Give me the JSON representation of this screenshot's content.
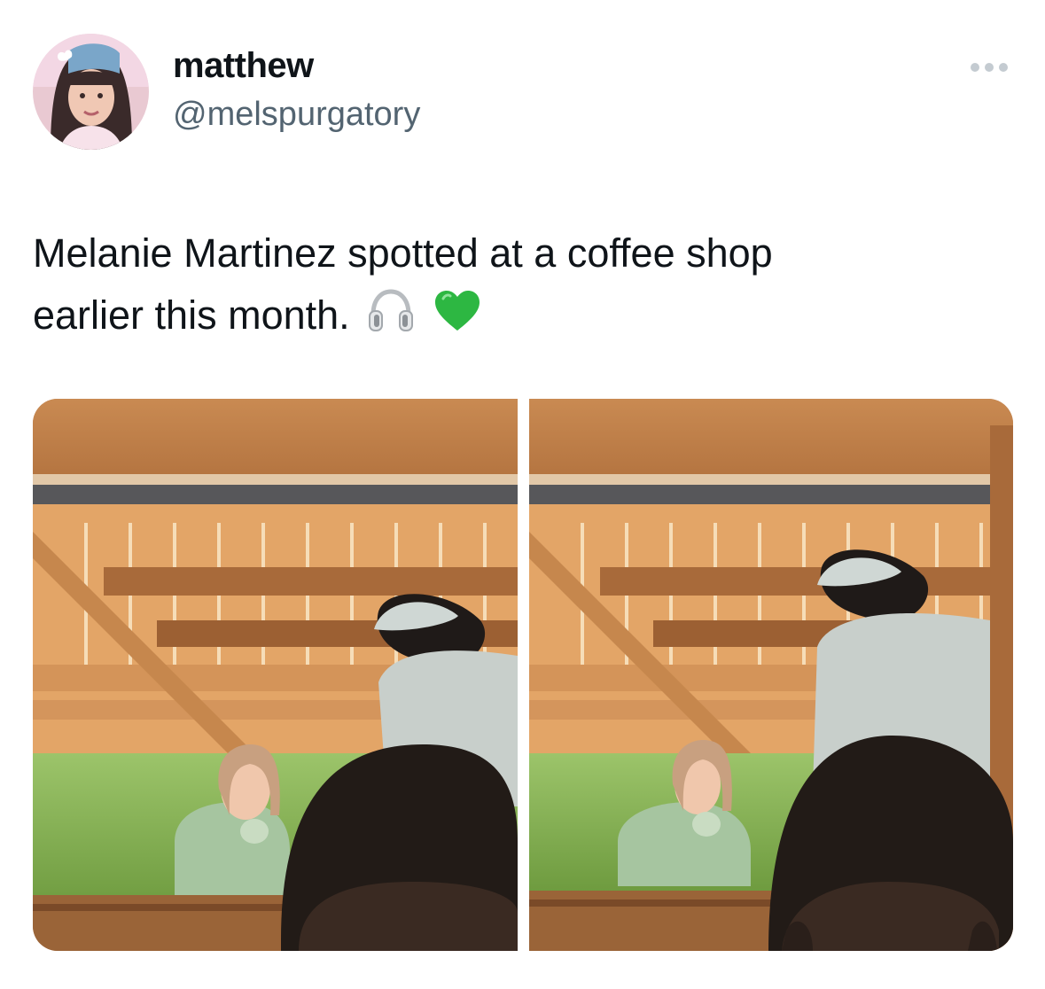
{
  "author": {
    "display_name": "matthew",
    "handle": "@melspurgatory",
    "avatar_icon": "avatar-photo"
  },
  "menu": {
    "icon": "more-options-icon"
  },
  "tweet": {
    "text_line1": "Melanie Martinez spotted at a coffee shop",
    "text_line2": "earlier this month.",
    "emojis": [
      "headphones-emoji",
      "green-heart-emoji"
    ]
  },
  "media": {
    "count": 2,
    "photos": [
      "coffee-shop-photo-1",
      "coffee-shop-photo-2"
    ]
  },
  "colors": {
    "text_primary": "#0f1419",
    "text_secondary": "#536471",
    "heart_green": "#2db742"
  }
}
